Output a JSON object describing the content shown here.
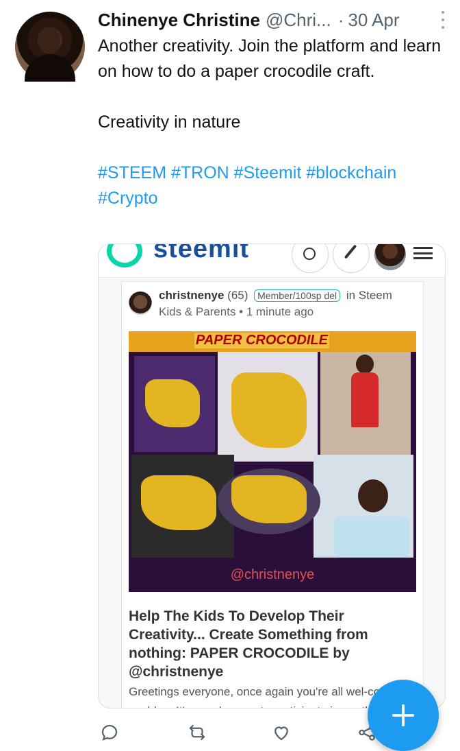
{
  "tweet": {
    "author_name": "Chinenye Christine",
    "author_handle": "@Chri...",
    "separator": "·",
    "date": "30 Apr",
    "text_line1": "Another creativity. Join the platform and learn on how to do a paper crocodile craft.",
    "text_line2": "Creativity in nature",
    "hashtags": "#STEEM #TRON #Steemit #blockchain #Crypto"
  },
  "card": {
    "site_name": "steemit",
    "post": {
      "author": "christnenye",
      "reputation": "(65)",
      "badge": "Member/100sp del",
      "in_label": "in Steem",
      "community_time": "Kids & Parents • 1 minute ago",
      "image_banner": "PAPER CROCODILE",
      "image_watermark": "@christnenye",
      "title": "Help The Kids To Develop Their Creativity... Create Something from nothing: PAPER CROCODILE by @christnenye",
      "excerpt": "Greetings everyone, once again you're all wel-come to my blog. It's my pleasure to participate in another craft contest..."
    }
  },
  "colors": {
    "accent": "#1d9bf0",
    "steemit_green": "#06d6a9",
    "steemit_blue": "#1a5099"
  },
  "icons": {
    "reply": "reply-icon",
    "retweet": "retweet-icon",
    "like": "heart-icon",
    "share": "share-icon",
    "compose": "plus-icon",
    "more": "more-vertical-icon"
  }
}
